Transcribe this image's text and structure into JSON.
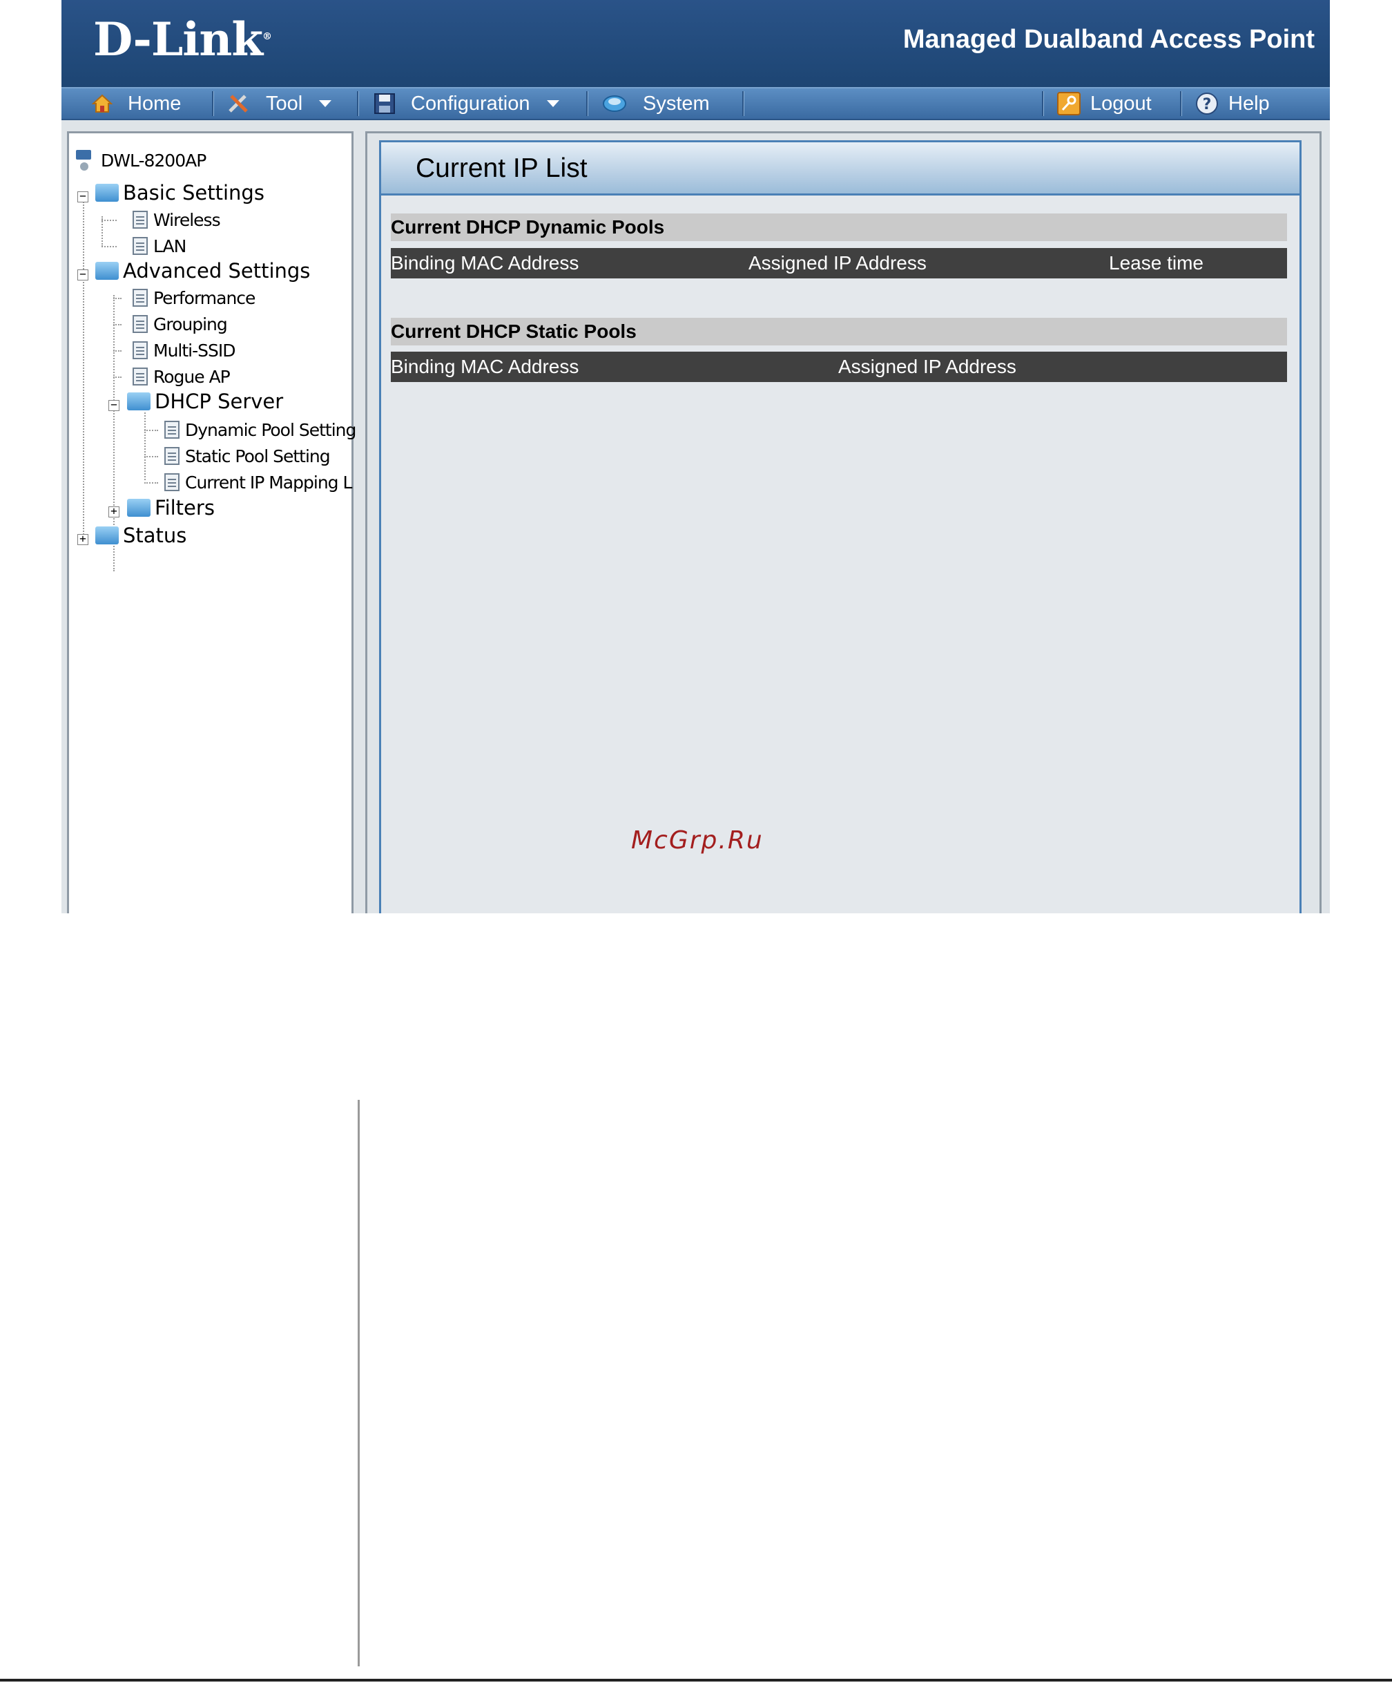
{
  "header": {
    "logo_text": "D-Link",
    "logo_reg": "®",
    "product_name": "Managed Dualband Access Point"
  },
  "menu": {
    "home": "Home",
    "tool": "Tool",
    "configuration": "Configuration",
    "system": "System",
    "logout": "Logout",
    "help": "Help"
  },
  "tree": {
    "root": "DWL-8200AP",
    "basic_settings": "Basic Settings",
    "wireless": "Wireless",
    "lan": "LAN",
    "advanced_settings": "Advanced Settings",
    "performance": "Performance",
    "grouping": "Grouping",
    "multi_ssid": "Multi-SSID",
    "rogue_ap": "Rogue AP",
    "dhcp_server": "DHCP Server",
    "dynamic_pool_setting": "Dynamic Pool Setting",
    "static_pool_setting": "Static Pool Setting",
    "current_ip_mapping": "Current IP Mapping L",
    "filters": "Filters",
    "status": "Status"
  },
  "page": {
    "title": "Current IP List",
    "dynamic_pools": {
      "heading": "Current DHCP Dynamic Pools",
      "columns": [
        "Binding MAC Address",
        "Assigned IP Address",
        "Lease time"
      ]
    },
    "static_pools": {
      "heading": "Current DHCP Static Pools",
      "columns": [
        "Binding MAC Address",
        "Assigned IP Address"
      ]
    }
  },
  "watermark": "McGrp.Ru",
  "colors": {
    "header_bg": "#1d4573",
    "menu_bg": "#4a7bb0",
    "section_bg": "#cacaca",
    "table_header_bg": "#404040",
    "panel_border": "#4a80b6"
  },
  "icons": [
    "home-icon",
    "tool-icon",
    "save-icon",
    "system-icon",
    "logout-key-icon",
    "help-icon",
    "folder-icon",
    "document-icon",
    "access-point-icon"
  ]
}
